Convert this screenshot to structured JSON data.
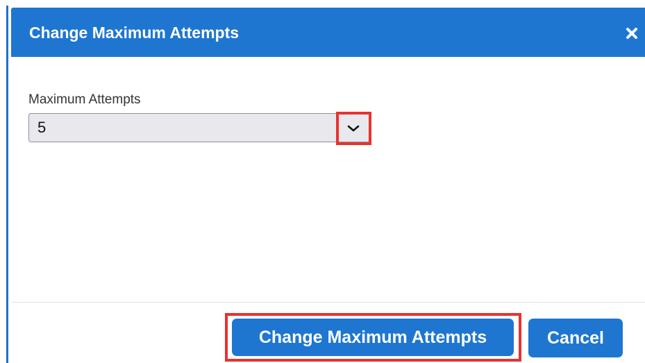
{
  "dialog": {
    "title": "Change Maximum Attempts",
    "close_icon": "close-icon"
  },
  "field": {
    "label": "Maximum Attempts",
    "selected_value": "5",
    "dropdown_icon": "chevron-down-icon"
  },
  "footer": {
    "primary_label": "Change Maximum Attempts",
    "cancel_label": "Cancel"
  },
  "colors": {
    "header": "#1e76d1",
    "button": "#1e76d1",
    "highlight": "#e8322f",
    "select_background": "#e9e9ed"
  }
}
